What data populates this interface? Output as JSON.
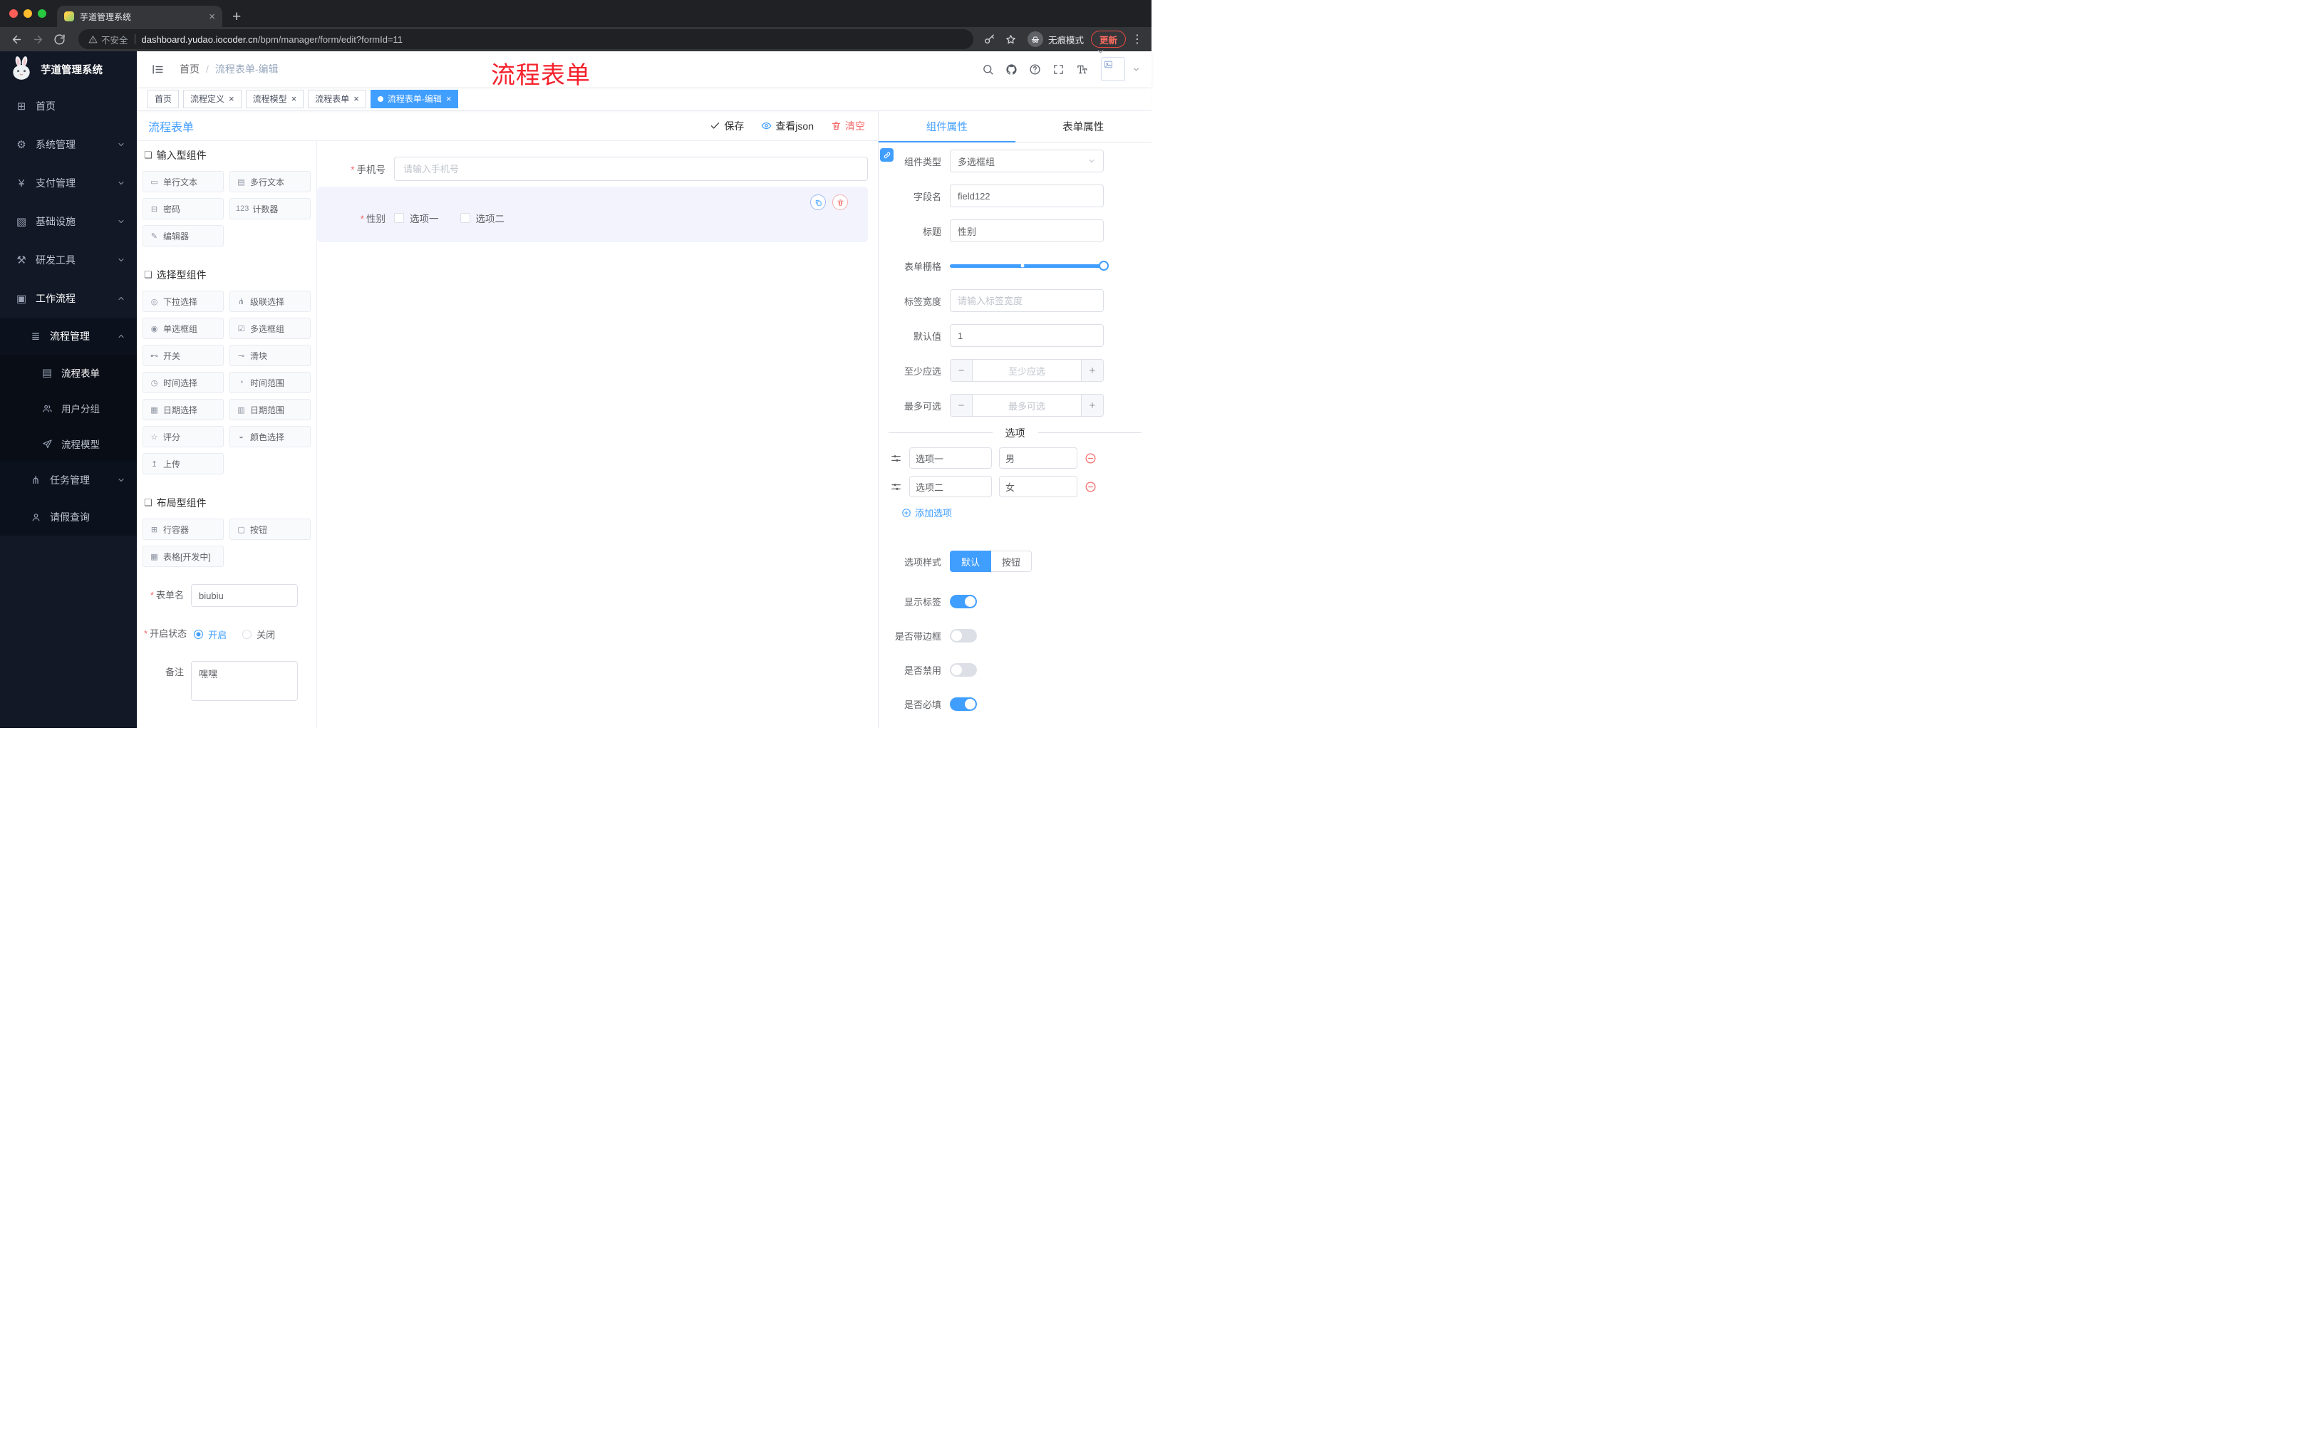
{
  "glyphs": {
    "close": "×",
    "new_tab": "+",
    "kebab": "⋮",
    "breadcrumb_sep": "/",
    "minus": "−",
    "plus": "+"
  },
  "colors": {
    "primary": "#409EFF",
    "danger": "#F56C6C",
    "annotation": "#F5222D",
    "sidebar_bg": "#121826",
    "chrome_bg": "#202124",
    "active_tag": "#409EFF"
  },
  "browser": {
    "tab_title": "芋道管理系统",
    "security_label": "不安全",
    "url_domain": "dashboard.yudao.iocoder.cn",
    "url_path": "/bpm/manager/form/edit?formId=11",
    "incognito_label": "无痕模式",
    "update_label": "更新"
  },
  "sidebar": {
    "logo_title": "芋道管理系统",
    "items": [
      {
        "label": "首页",
        "icon": "⊞"
      },
      {
        "label": "系统管理",
        "icon": "⚙"
      },
      {
        "label": "支付管理",
        "icon": "¥"
      },
      {
        "label": "基础设施",
        "icon": "▧"
      },
      {
        "label": "研发工具",
        "icon": "⚒"
      },
      {
        "label": "工作流程",
        "icon": "▣"
      },
      {
        "label": "流程管理",
        "icon": "≣"
      },
      {
        "label": "流程表单",
        "icon": "▤"
      },
      {
        "label": "用户分组",
        "icon": ""
      },
      {
        "label": "流程模型",
        "icon": ""
      },
      {
        "label": "任务管理",
        "icon": "⋔"
      },
      {
        "label": "请假查询",
        "icon": ""
      }
    ]
  },
  "navbar": {
    "breadcrumb": [
      "首页",
      "流程表单-编辑"
    ],
    "annotation": "流程表单"
  },
  "tags": [
    {
      "label": "首页"
    },
    {
      "label": "流程定义"
    },
    {
      "label": "流程模型"
    },
    {
      "label": "流程表单"
    },
    {
      "label": "流程表单-编辑"
    }
  ],
  "designer": {
    "title": "流程表单",
    "save_label": "保存",
    "view_json_label": "查看json",
    "clear_label": "清空"
  },
  "palette": {
    "group1": {
      "title": "输入型组件",
      "items": [
        {
          "label": "单行文本",
          "icon": "▭"
        },
        {
          "label": "多行文本",
          "icon": "▤"
        },
        {
          "label": "密码",
          "icon": "⊟"
        },
        {
          "label": "计数器",
          "icon": "123"
        },
        {
          "label": "编辑器",
          "icon": "✎"
        }
      ]
    },
    "group2": {
      "title": "选择型组件",
      "items": [
        {
          "label": "下拉选择",
          "icon": "◎"
        },
        {
          "label": "级联选择",
          "icon": "⋔"
        },
        {
          "label": "单选框组",
          "icon": "◉"
        },
        {
          "label": "多选框组",
          "icon": "☑"
        },
        {
          "label": "开关",
          "icon": "⊷"
        },
        {
          "label": "滑块",
          "icon": "⊸"
        },
        {
          "label": "时间选择",
          "icon": "◷"
        },
        {
          "label": "时间范围",
          "icon": "◔"
        },
        {
          "label": "日期选择",
          "icon": "▦"
        },
        {
          "label": "日期范围",
          "icon": "▥"
        },
        {
          "label": "评分",
          "icon": "☆"
        },
        {
          "label": "颜色选择",
          "icon": "◒"
        },
        {
          "label": "上传",
          "icon": "↥"
        }
      ]
    },
    "group3": {
      "title": "布局型组件",
      "items": [
        {
          "label": "行容器",
          "icon": "⊞"
        },
        {
          "label": "按钮",
          "icon": "▢"
        },
        {
          "label": "表格[开发中]",
          "icon": "▦"
        }
      ]
    }
  },
  "form_meta": {
    "name_label": "表单名",
    "name_value": "biubiu",
    "status_label": "开启状态",
    "status_on_label": "开启",
    "status_off_label": "关闭",
    "remark_label": "备注",
    "remark_value": "嘿嘿"
  },
  "canvas": {
    "phone": {
      "label": "手机号",
      "placeholder": "请输入手机号"
    },
    "gender": {
      "label": "性别",
      "options": [
        "选项一",
        "选项二"
      ]
    }
  },
  "props": {
    "tab_component": "组件属性",
    "tab_form": "表单属性",
    "rows": {
      "component_type": {
        "label": "组件类型",
        "value": "多选框组"
      },
      "field_name": {
        "label": "字段名",
        "value": "field122"
      },
      "title": {
        "label": "标题",
        "value": "性别"
      },
      "grid": {
        "label": "表单栅格"
      },
      "label_width": {
        "label": "标签宽度",
        "placeholder": "请输入标签宽度"
      },
      "default_value": {
        "label": "默认值",
        "value": "1"
      },
      "min_select": {
        "label": "至少应选",
        "placeholder": "至少应选"
      },
      "max_select": {
        "label": "最多可选",
        "placeholder": "最多可选"
      }
    },
    "options_title": "选项",
    "options": [
      {
        "label": "选项一",
        "value": "男"
      },
      {
        "label": "选项二",
        "value": "女"
      }
    ],
    "add_option_label": "添加选项",
    "option_style": {
      "label": "选项样式",
      "default_label": "默认",
      "button_label": "按钮",
      "selected": "默认"
    },
    "toggles": [
      {
        "label": "显示标签",
        "on": true
      },
      {
        "label": "是否带边框",
        "on": false
      },
      {
        "label": "是否禁用",
        "on": false
      },
      {
        "label": "是否必填",
        "on": true
      }
    ]
  }
}
